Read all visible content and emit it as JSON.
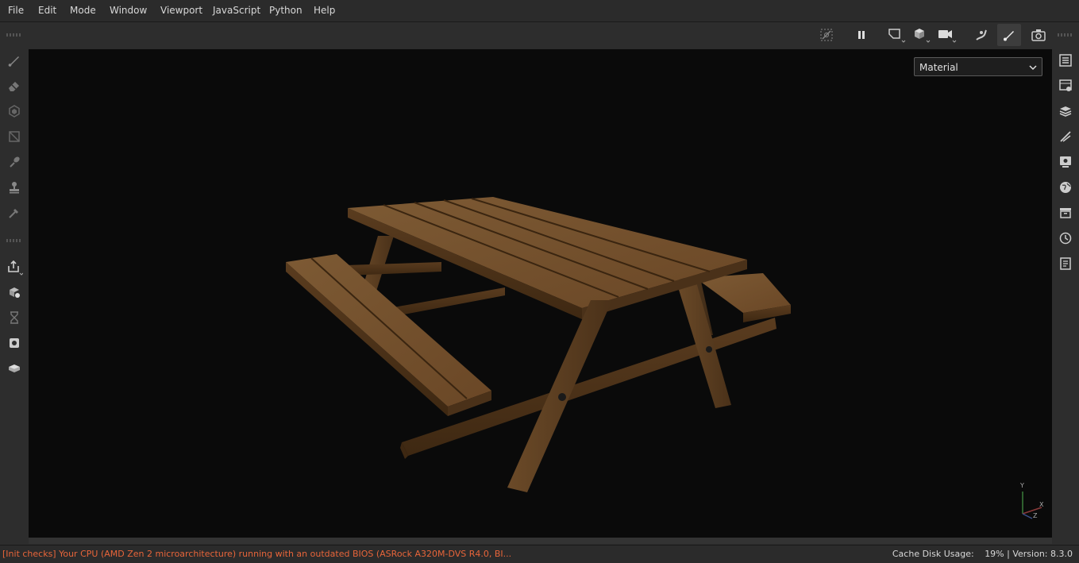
{
  "menu": [
    "File",
    "Edit",
    "Mode",
    "Window",
    "Viewport",
    "JavaScript",
    "Python",
    "Help"
  ],
  "viewport": {
    "mode_select": "Material",
    "axis": {
      "x": "X",
      "y": "Y",
      "z": "Z"
    }
  },
  "left_tools": [
    "paint-brush-icon",
    "eraser-icon",
    "projection-icon",
    "polygon-fill-icon",
    "smudge-icon",
    "clone-stamp-icon",
    "color-picker-icon",
    "export-icon",
    "bake-icon",
    "hourglass-icon",
    "iray-icon",
    "material-icon"
  ],
  "right_panels": [
    "layers-list-icon",
    "texture-set-icon",
    "layer-stack-icon",
    "properties-icon",
    "display-settings-icon",
    "environment-icon",
    "shelf-icon",
    "history-icon",
    "log-icon"
  ],
  "status": {
    "message": "[Init checks] Your CPU (AMD Zen 2 microarchitecture) running with an outdated BIOS (ASRock A320M-DVS R4.0, BI...",
    "cache_label": "Cache Disk Usage:",
    "cache_value": "19%",
    "version_label": "Version:",
    "version_value": "8.3.0"
  },
  "colors": {
    "accent_warning": "#e8653a",
    "viewport_bg": "#0a0a0a",
    "wood": "#7a5530"
  }
}
